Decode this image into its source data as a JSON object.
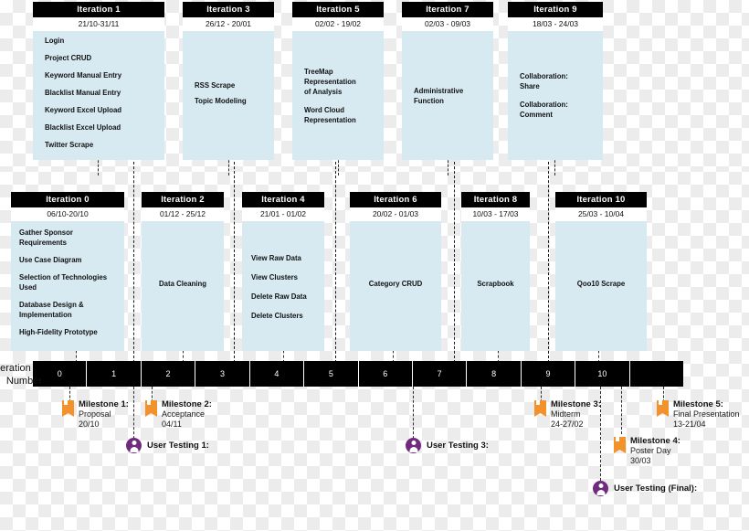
{
  "axis": {
    "label_line1": "Iteration",
    "label_line2": "Number",
    "cells": [
      "0",
      "1",
      "2",
      "3",
      "4",
      "5",
      "6",
      "7",
      "8",
      "9",
      "10",
      ""
    ]
  },
  "colors": {
    "header": "#000000",
    "body": "#d7eaf2",
    "milestone": "#f3922b",
    "usertest": "#702b7f"
  },
  "iterations_top": [
    {
      "title": "Iteration 1",
      "dates": "21/10-31/11",
      "tasks": [
        "Login",
        "Project CRUD",
        "Keyword Manual Entry",
        "Blacklist Manual Entry",
        "Keyword Excel Upload",
        "Blacklist Excel Upload",
        "Twitter Scrape"
      ]
    },
    {
      "title": "Iteration 3",
      "dates": "26/12 - 20/01",
      "tasks": [
        "RSS Scrape",
        "Topic Modeling"
      ]
    },
    {
      "title": "Iteration 5",
      "dates": "02/02 - 19/02",
      "tasks": [
        "TreeMap",
        "Representation",
        "of Analysis",
        "",
        "Word Cloud",
        "Representation"
      ]
    },
    {
      "title": "Iteration 7",
      "dates": "02/03 - 09/03",
      "tasks": [
        "Administrative",
        "Function"
      ]
    },
    {
      "title": "Iteration 9",
      "dates": "18/03 - 24/03",
      "tasks": [
        "Collaboration:",
        "Share",
        "",
        "Collaboration:",
        "Comment"
      ]
    }
  ],
  "iterations_bottom": [
    {
      "title": "Iteration 0",
      "dates": "06/10-20/10",
      "tasks": [
        "Gather Sponsor",
        "Requirements",
        "Use Case Diagram",
        "Selection of Technologies",
        "Used",
        "Database Design &",
        "Implementation",
        "High-Fidelity Prototype"
      ]
    },
    {
      "title": "Iteration 2",
      "dates": "01/12 - 25/12",
      "tasks": [
        "Data Cleaning"
      ]
    },
    {
      "title": "Iteration 4",
      "dates": "21/01 - 01/02",
      "tasks": [
        "View Raw Data",
        "View Clusters",
        "Delete Raw Data",
        "Delete Clusters"
      ]
    },
    {
      "title": "Iteration 6",
      "dates": "20/02 - 01/03",
      "tasks": [
        "Category CRUD"
      ]
    },
    {
      "title": "Iteration 8",
      "dates": "10/03 - 17/03",
      "tasks": [
        "Scrapbook"
      ]
    },
    {
      "title": "Iteration 10",
      "dates": "25/03 - 10/04",
      "tasks": [
        "Qoo10 Scrape"
      ]
    }
  ],
  "milestones": [
    {
      "name": "Milestone 1:",
      "detail": "Proposal",
      "date": "20/10"
    },
    {
      "name": "Milestone 2:",
      "detail": "Acceptance",
      "date": "04/11"
    },
    {
      "name": "Milestone 3:",
      "detail": "Midterm",
      "date": "24-27/02"
    },
    {
      "name": "Milestone 4:",
      "detail": "Poster Day",
      "date": "30/03"
    },
    {
      "name": "Milestone 5:",
      "detail": "Final Presentation",
      "date": "13-21/04"
    }
  ],
  "user_tests": [
    {
      "label": "User Testing 1:"
    },
    {
      "label": "User Testing 3:"
    },
    {
      "label": "User Testing (Final):"
    }
  ]
}
